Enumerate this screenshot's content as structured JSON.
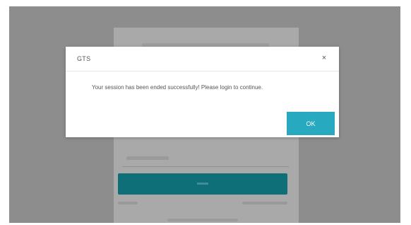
{
  "dialog": {
    "title": "GTS",
    "close_glyph": "×",
    "message": "Your session has been ended successfully! Please login to continue.",
    "ok_label": "OK"
  },
  "login": {
    "accent_color": "#0f6f78"
  },
  "colors": {
    "overlay": "#8d8d8d",
    "dialog_button": "#27a9bf"
  },
  "icons": {
    "close": "close-icon"
  }
}
